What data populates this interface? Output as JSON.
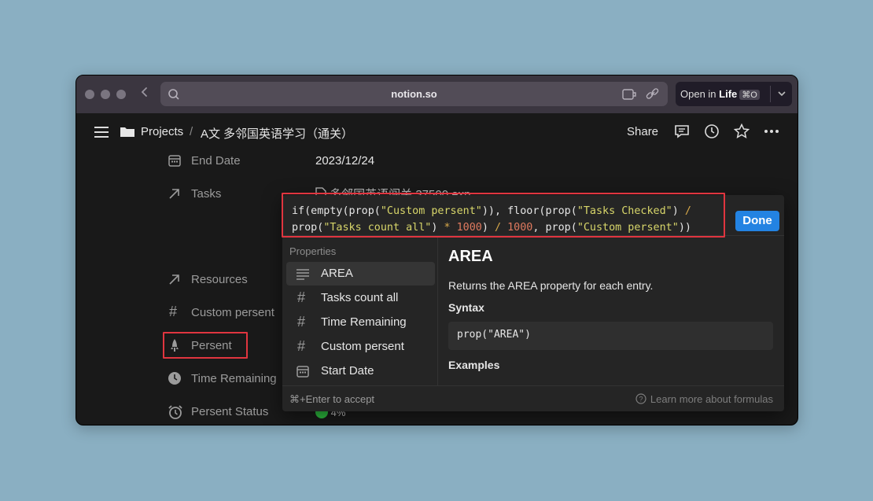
{
  "browser": {
    "url": "notion.so",
    "open_in_label": "Open in",
    "open_in_app": "Life",
    "open_in_shortcut": "⌘O"
  },
  "header": {
    "breadcrumb_projects": "Projects",
    "breadcrumb_sep": "/",
    "page_icon_text": "A文",
    "page_title": "多邻国英语学习（通关）",
    "share_label": "Share"
  },
  "properties": [
    {
      "label": "End Date",
      "icon": "calendar-icon",
      "value": "2023/12/24"
    },
    {
      "label": "Tasks",
      "icon": "arrow-relation-icon",
      "value": "多邻国英语闯关 37500 exp"
    },
    {
      "label": "Resources",
      "icon": "arrow-relation-icon"
    },
    {
      "label": "Custom persent",
      "icon": "number-icon"
    },
    {
      "label": "Persent",
      "icon": "formula-icon"
    },
    {
      "label": "Time Remaining",
      "icon": "clock-icon"
    },
    {
      "label": "Persent Status",
      "icon": "alarm-icon",
      "value": "4%"
    }
  ],
  "formula": {
    "line1_a": "if(empty(prop(",
    "line1_s1": "\"Custom persent\"",
    "line1_b": ")), floor(prop(",
    "line1_s2": "\"Tasks Checked\"",
    "line1_c": ") ",
    "line1_op": "/",
    "line2_a": "prop(",
    "line2_s1": "\"Tasks count all\"",
    "line2_b": ") ",
    "line2_op1": "*",
    "line2_sp": " ",
    "line2_n1": "1000",
    "line2_c": ") ",
    "line2_op2": "/",
    "line2_sp2": " ",
    "line2_n2": "1000",
    "line2_d": ", prop(",
    "line2_s2": "\"Custom persent\"",
    "line2_e": "))",
    "done_label": "Done"
  },
  "properties_panel": {
    "title": "Properties",
    "items": [
      {
        "label": "AREA",
        "icon": "text-lines-icon",
        "selected": true
      },
      {
        "label": "Tasks count all",
        "icon": "number-icon"
      },
      {
        "label": "Time Remaining",
        "icon": "number-icon"
      },
      {
        "label": "Custom persent",
        "icon": "number-icon"
      },
      {
        "label": "Start Date",
        "icon": "calendar-icon"
      }
    ]
  },
  "detail": {
    "title": "AREA",
    "description": "Returns the AREA property for each entry.",
    "syntax_heading": "Syntax",
    "syntax_code": "prop(\"AREA\")",
    "examples_heading": "Examples"
  },
  "footer": {
    "accept_hint": "⌘+Enter to accept",
    "learn_more": "Learn more about formulas"
  },
  "colors": {
    "accent": "#2383e2",
    "highlight": "#e0353f",
    "string": "#d8d66a",
    "number": "#e07a5f",
    "status_green": "#2dbc3f"
  }
}
